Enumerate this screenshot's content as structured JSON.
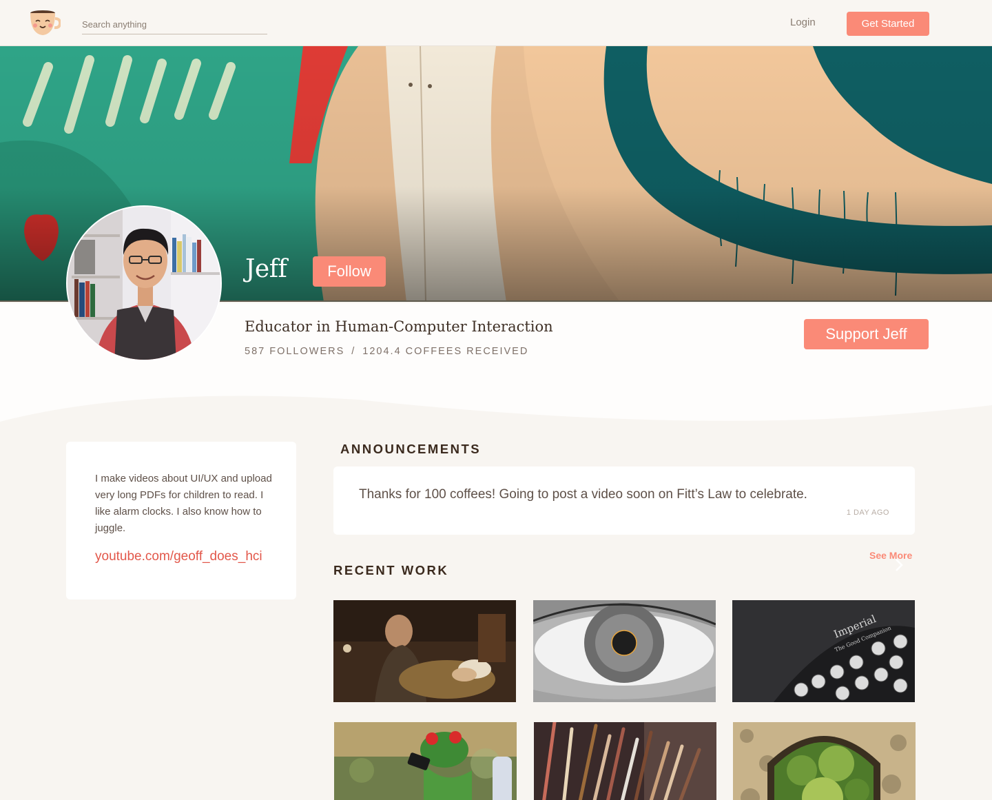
{
  "nav": {
    "logo_icon": "coffee-cup-face-icon",
    "search_placeholder": "Search anything",
    "login_label": "Login",
    "get_started_label": "Get Started"
  },
  "profile": {
    "name": "Jeff",
    "follow_label": "Follow",
    "tagline": "Educator in Human-Computer Interaction",
    "followers": "587 FOLLOWERS",
    "stats_separator": "/",
    "coffees": "1204.4 COFFEES RECEIVED",
    "support_label": "Support Jeff"
  },
  "about": {
    "bio": "I make videos about UI/UX and upload very long PDFs for children to read. I like alarm clocks. I also know how to juggle.",
    "link": "youtube.com/geoff_does_hci"
  },
  "announcements": {
    "title": "ANNOUNCEMENTS",
    "items": [
      {
        "text": "Thanks for 100 coffees! Going to post a video soon on Fitt’s Law to celebrate.",
        "time": "1 DAY AGO"
      }
    ]
  },
  "recent_work": {
    "title": "RECENT WORK",
    "see_more_label": "See More",
    "items": [
      {
        "name": "painting-old-man"
      },
      {
        "name": "eye-closeup"
      },
      {
        "name": "typewriter",
        "label": "Imperial",
        "sublabel": "The Good Companion"
      },
      {
        "name": "frog-figurine"
      },
      {
        "name": "paint-brushes"
      },
      {
        "name": "garden-arch"
      }
    ]
  },
  "colors": {
    "accent": "#fa8a77",
    "link": "#e2574a",
    "page_bg": "#f8f5f1",
    "heading": "#3b2a1e"
  }
}
